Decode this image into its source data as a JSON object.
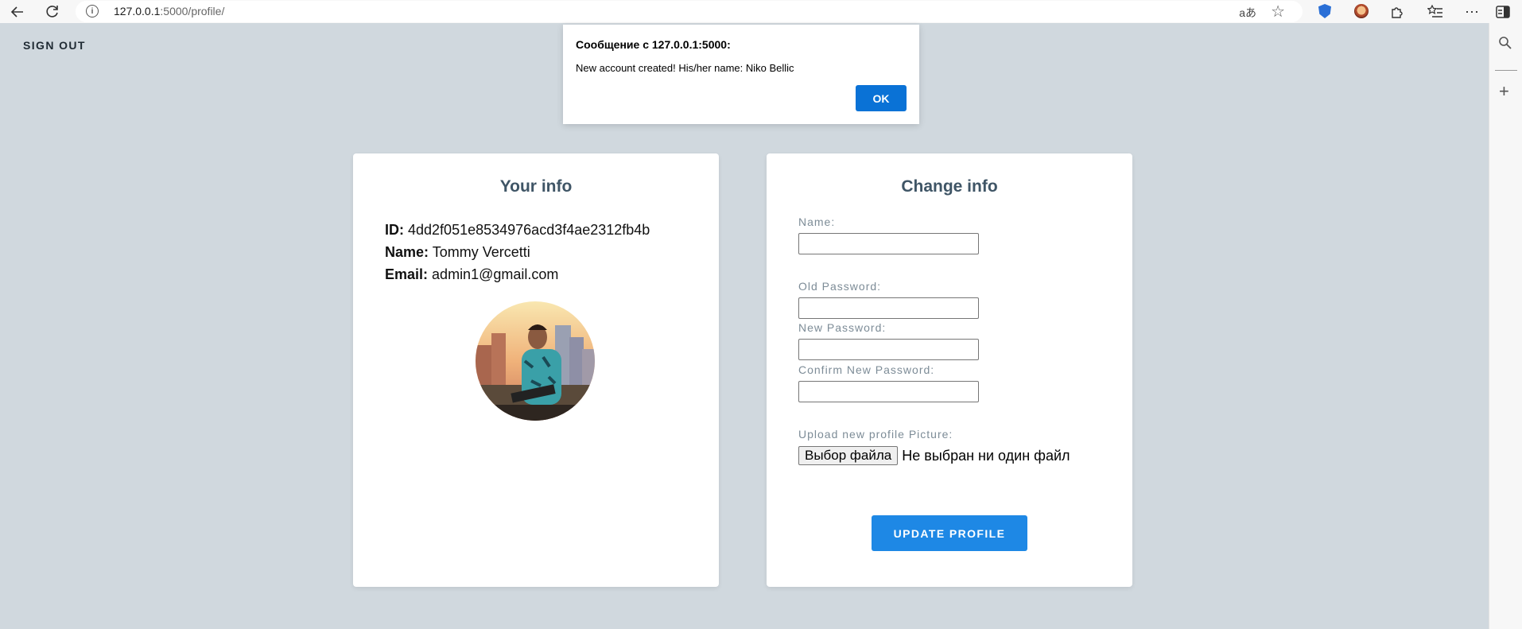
{
  "browser": {
    "url_host": "127.0.0.1",
    "url_path": ":5000/profile/",
    "read_aloud": "aあ"
  },
  "page": {
    "sign_out": "SIGN OUT"
  },
  "your_info": {
    "title": "Your info",
    "id_label": "ID:",
    "id_value": "4dd2f051e8534976acd3f4ae2312fb4b",
    "name_label": "Name:",
    "name_value": "Tommy Vercetti",
    "email_label": "Email:",
    "email_value": "admin1@gmail.com"
  },
  "change_info": {
    "title": "Change info",
    "name_label": "Name:",
    "old_password_label": "Old Password:",
    "new_password_label": "New Password:",
    "confirm_password_label": "Confirm New Password:",
    "upload_label": "Upload new profile Picture:",
    "file_button": "Выбор файла",
    "file_status": "Не выбран ни один файл",
    "update_button": "UPDATE PROFILE"
  },
  "dialog": {
    "title": "Сообщение с 127.0.0.1:5000:",
    "message": "New account created! His/her name: Niko Bellic",
    "ok": "OK"
  },
  "colors": {
    "page_background": "#d0d8de",
    "accent": "#1e88e5",
    "dialog_ok": "#0a72d6",
    "card_title": "#3f5566",
    "label": "#7d8c97"
  }
}
